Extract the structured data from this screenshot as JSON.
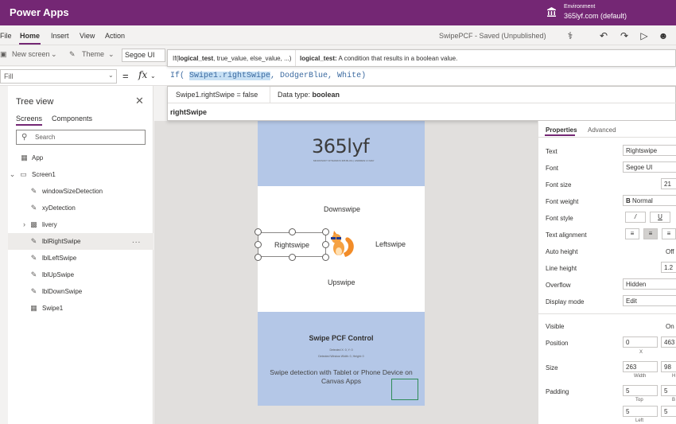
{
  "app": {
    "title": "Power Apps"
  },
  "environment": {
    "label": "Environment",
    "value": "365lyf.com (default)"
  },
  "menu": {
    "items": [
      "File",
      "Home",
      "Insert",
      "View",
      "Action"
    ],
    "save_status": "SwipePCF - Saved (Unpublished)"
  },
  "ribbon": {
    "new_screen": "New screen",
    "theme": "Theme",
    "font": "Segoe UI"
  },
  "formula": {
    "property": "Fill",
    "eq": "=",
    "fx": "fx",
    "code_pre": "If( ",
    "code_highlight": "Swipe1.rightSwipe",
    "code_post": ", DodgerBlue, White)",
    "signature_bold": "logical_test",
    "signature_pre": "If(",
    "signature_post": ", true_value, else_value, ...)",
    "desc_bold": "logical_test:",
    "desc_text": " A condition that results in a boolean value.",
    "result_expr": "Swipe1.rightSwipe  =  false",
    "result_type_label": "Data type: ",
    "result_type": "boolean",
    "suggestion": "rightSwipe"
  },
  "tree": {
    "title": "Tree view",
    "tabs": [
      "Screens",
      "Components"
    ],
    "search_placeholder": "Search",
    "app": "App",
    "screen": "Screen1",
    "children": [
      "windowSizeDetection",
      "xyDetection",
      "livery",
      "lblRightSwipe",
      "lblLeftSwipe",
      "lblUpSwipe",
      "lblDownSwipe",
      "Swipe1"
    ],
    "more": "..."
  },
  "canvas": {
    "logo": "365lyf",
    "logo_sub": "MICROSOFT DYNAMICS 365 BLOG  |  ANDREW LY-MAY",
    "downswipe": "Downswipe",
    "rightswipe": "Rightswipe",
    "leftswipe": "Leftswipe",
    "upswipe": "Upswipe",
    "footer_title": "Swipe PCF Control",
    "footer_line1": "Detected X: 0, Y: 0",
    "footer_line2": "Detected Window Width: 0, Height: 0",
    "footer_desc": "Swipe detection with Tablet or Phone Device on Canvas Apps"
  },
  "properties": {
    "tabs": [
      "Properties",
      "Advanced"
    ],
    "text_label": "Text",
    "text_value": "Rightswipe",
    "font_label": "Font",
    "font_value": "Segoe UI",
    "font_size_label": "Font size",
    "font_size_value": "21",
    "font_weight_label": "Font weight",
    "font_weight_value": "Normal",
    "font_style_label": "Font style",
    "text_align_label": "Text alignment",
    "auto_height_label": "Auto height",
    "auto_height_value": "Off",
    "line_height_label": "Line height",
    "line_height_value": "1.2",
    "overflow_label": "Overflow",
    "overflow_value": "Hidden",
    "display_mode_label": "Display mode",
    "display_mode_value": "Edit",
    "visible_label": "Visible",
    "visible_value": "On",
    "position_label": "Position",
    "position_x": "0",
    "position_y": "463",
    "x_label": "X",
    "size_label": "Size",
    "width": "263",
    "height": "98",
    "width_label": "Width",
    "height_label": "H",
    "padding_label": "Padding",
    "pad_top": "5",
    "pad_bottom": "5",
    "pad_left": "5",
    "pad_right": "5",
    "top_label": "Top",
    "bottom_label": "B",
    "left_label": "Left"
  },
  "colors": {
    "brand": "#742774",
    "band": "#b4c7e7"
  }
}
